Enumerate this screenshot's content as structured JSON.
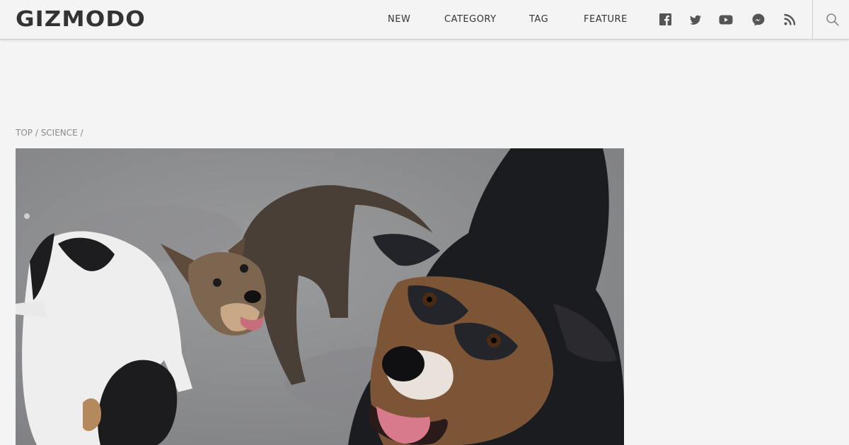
{
  "site": {
    "logo": "GIZMODO"
  },
  "nav": {
    "items": [
      {
        "label": "NEW"
      },
      {
        "label": "CATEGORY"
      },
      {
        "label": "TAG"
      },
      {
        "label": "FEATURE"
      }
    ]
  },
  "social": {
    "icons": [
      "facebook-icon",
      "twitter-icon",
      "youtube-icon",
      "messenger-icon",
      "rss-icon"
    ]
  },
  "breadcrumb": {
    "top": "TOP",
    "separator": " / ",
    "section": "SCIENCE",
    "trailing": " /"
  },
  "hero": {
    "subject": "three stray dogs on pavement looking up at the camera"
  },
  "colors": {
    "background": "#f4f4f4",
    "text": "#333333",
    "muted": "#8a8a8a"
  }
}
